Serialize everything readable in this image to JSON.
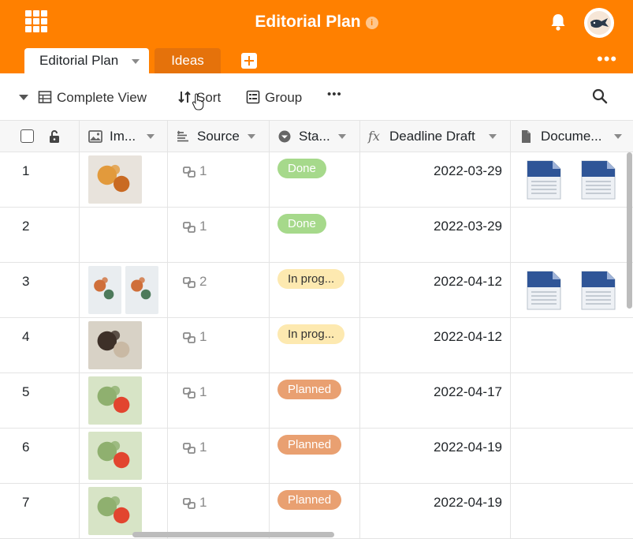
{
  "app": {
    "title": "Editorial Plan",
    "info_icon": "info-icon",
    "accent_color": "#ff8000"
  },
  "tabs": [
    {
      "label": "Editorial Plan",
      "active": true
    },
    {
      "label": "Ideas",
      "active": false
    }
  ],
  "toolbar": {
    "view_label": "Complete View",
    "sort_label": "Sort",
    "group_label": "Group",
    "more_label": "•••"
  },
  "columns": [
    {
      "label": "Im...",
      "icon": "image-icon"
    },
    {
      "label": "Source",
      "icon": "link-icon"
    },
    {
      "label": "Sta...",
      "icon": "single-select-icon"
    },
    {
      "label": "Deadline Draft",
      "icon": "formula-icon"
    },
    {
      "label": "Docume...",
      "icon": "file-icon"
    }
  ],
  "rows": [
    {
      "num": "1",
      "source": "1",
      "status": "Done",
      "status_kind": "done",
      "deadline": "2022-03-29",
      "images": 1,
      "docs": 2
    },
    {
      "num": "2",
      "source": "1",
      "status": "Done",
      "status_kind": "done",
      "deadline": "2022-03-29",
      "images": 0,
      "docs": 0
    },
    {
      "num": "3",
      "source": "2",
      "status": "In prog...",
      "status_kind": "prog",
      "deadline": "2022-04-12",
      "images": 2,
      "docs": 2
    },
    {
      "num": "4",
      "source": "1",
      "status": "In prog...",
      "status_kind": "prog",
      "deadline": "2022-04-12",
      "images": 1,
      "docs": 0
    },
    {
      "num": "5",
      "source": "1",
      "status": "Planned",
      "status_kind": "plan",
      "deadline": "2022-04-17",
      "images": 1,
      "docs": 0
    },
    {
      "num": "6",
      "source": "1",
      "status": "Planned",
      "status_kind": "plan",
      "deadline": "2022-04-19",
      "images": 1,
      "docs": 0
    },
    {
      "num": "7",
      "source": "1",
      "status": "Planned",
      "status_kind": "plan",
      "deadline": "2022-04-19",
      "images": 1,
      "docs": 0
    }
  ],
  "status_colors": {
    "done": "#a6d98b",
    "prog": "#fde9b0",
    "plan": "#e9a071"
  }
}
